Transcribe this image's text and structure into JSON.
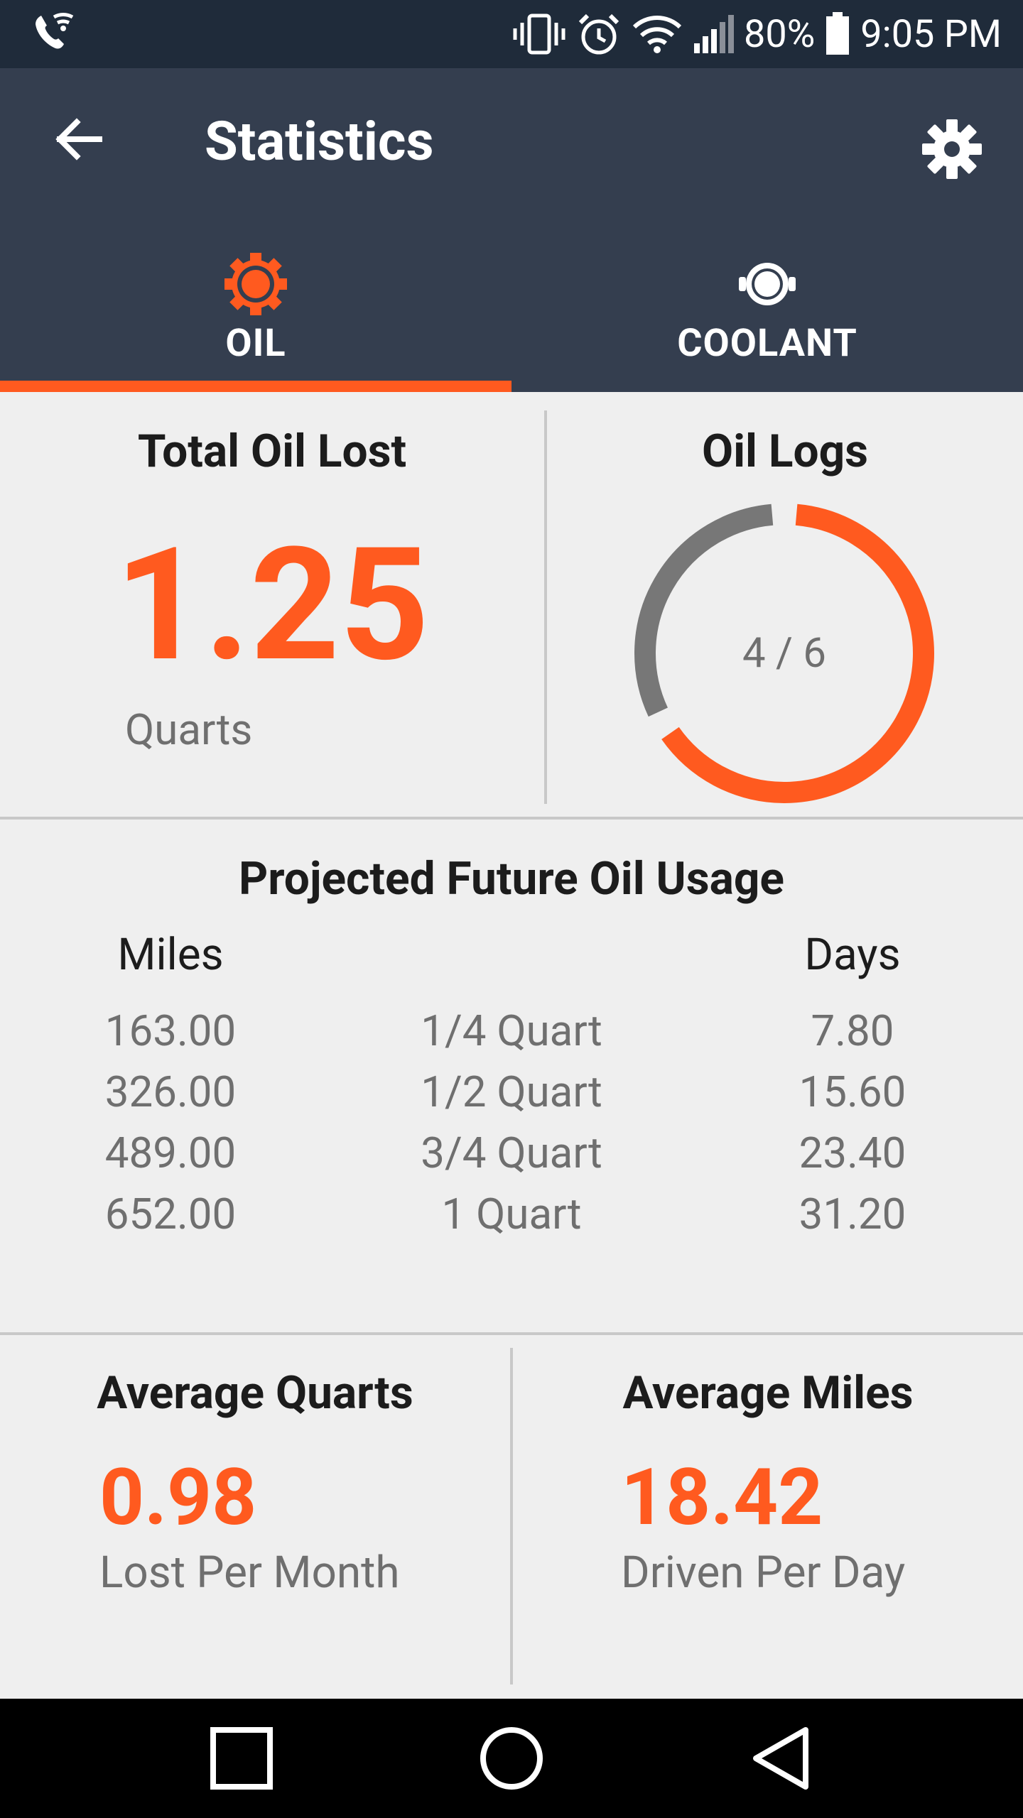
{
  "status_bar": {
    "battery": "80%",
    "time": "9:05 PM",
    "icons": [
      "wifi-calling-icon",
      "vibrate-icon",
      "alarm-icon",
      "wifi-icon",
      "signal-icon",
      "battery-icon"
    ]
  },
  "app_bar": {
    "title": "Statistics",
    "back_icon": "arrow-back-icon",
    "settings_icon": "gear-icon"
  },
  "tabs": [
    {
      "label": "OIL",
      "icon": "oil-icon",
      "selected": true
    },
    {
      "label": "COOLANT",
      "icon": "coolant-icon",
      "selected": false
    }
  ],
  "total_oil_lost": {
    "title": "Total Oil Lost",
    "value": "1.25",
    "unit": "Quarts"
  },
  "oil_logs": {
    "title": "Oil Logs",
    "label": "4 / 6",
    "completed": 4,
    "total": 6
  },
  "projection": {
    "title": "Projected Future Oil Usage",
    "miles_header": "Miles",
    "days_header": "Days",
    "rows": [
      {
        "miles": "163.00",
        "amount": "1/4 Quart",
        "days": "7.80"
      },
      {
        "miles": "326.00",
        "amount": "1/2 Quart",
        "days": "15.60"
      },
      {
        "miles": "489.00",
        "amount": "3/4 Quart",
        "days": "23.40"
      },
      {
        "miles": "652.00",
        "amount": "1 Quart",
        "days": "31.20"
      }
    ]
  },
  "average_quarts": {
    "title": "Average Quarts",
    "value": "0.98",
    "subtitle": "Lost Per Month"
  },
  "average_miles": {
    "title": "Average Miles",
    "value": "18.42",
    "subtitle": "Driven Per Day"
  },
  "nav_bar": {
    "icons": [
      "recents-icon",
      "home-icon",
      "back-triangle-icon"
    ]
  },
  "colors": {
    "accent": "#ff5a1f",
    "app_bar": "#343e4f",
    "status_bar": "#1f2b3a",
    "background": "#efefef",
    "ring_remaining": "#777777"
  }
}
